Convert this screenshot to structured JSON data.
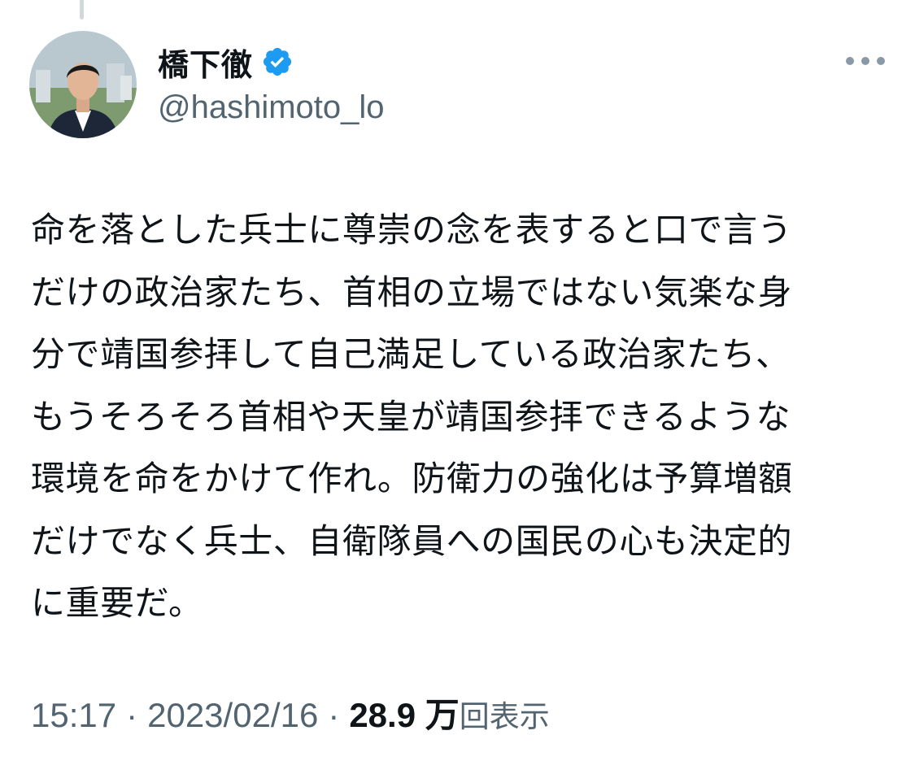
{
  "tweet": {
    "author": {
      "display_name": "橋下徹",
      "handle": "@hashimoto_lo",
      "verified": true,
      "verified_icon": "verified-badge-icon",
      "avatar": "profile-photo"
    },
    "more_icon": "more-options-icon",
    "text": "命を落とした兵士に尊崇の念を表すると口で言う\nだけの政治家たち、首相の立場ではない気楽な身\n分で靖国参拝して自己満足している政治家たち、\nもうそろそろ首相や天皇が靖国参拝できるような\n環境を命をかけて作れ。防衛力の強化は予算増額\nだけでなく兵士、自衛隊員への国民の心も決定的\nに重要だ。",
    "time": "15:17",
    "date": "2023/02/16",
    "separator": "·",
    "views_count": "28.9 万",
    "views_label": "回表示"
  },
  "colors": {
    "text_primary": "#0f1419",
    "text_secondary": "#536471",
    "verified_blue": "#1d9bf0",
    "background": "#ffffff"
  }
}
